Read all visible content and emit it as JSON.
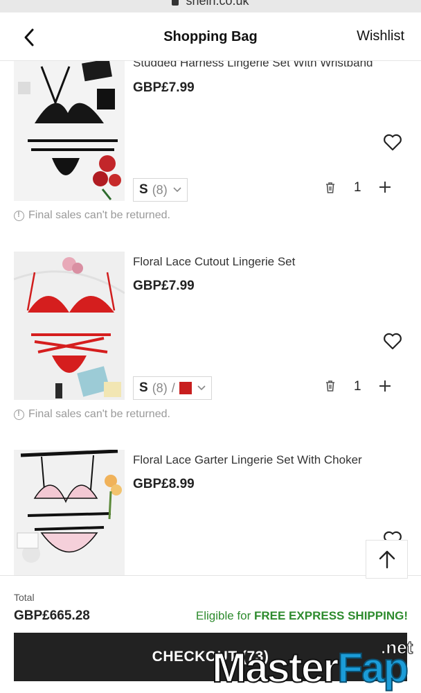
{
  "browser": {
    "url": "shein.co.uk"
  },
  "header": {
    "title": "Shopping Bag",
    "wishlist": "Wishlist"
  },
  "items": [
    {
      "name": "Studded Harness Lingerie Set With Wristband",
      "price": "GBP£7.99",
      "size": "S",
      "size_count": "(8)",
      "quantity": "1",
      "note": "Final sales can't be returned."
    },
    {
      "name": "Floral Lace Cutout Lingerie Set",
      "price": "GBP£7.99",
      "size": "S",
      "size_count": "(8)",
      "size_sep": "/",
      "swatch_color": "#c81e1e",
      "quantity": "1",
      "note": "Final sales can't be returned."
    },
    {
      "name": "Floral Lace Garter Lingerie Set With Choker",
      "price": "GBP£8.99"
    }
  ],
  "footer": {
    "total_label": "Total",
    "total_value": "GBP£665.28",
    "shipping_prefix": "Eligible for ",
    "shipping_highlight": "FREE EXPRESS SHIPPING!",
    "checkout_label": "CHECKOUT (73)"
  },
  "watermark": {
    "main": "Master",
    "accent": "Fap",
    "suffix": ".net"
  },
  "colors": {
    "shipping_green": "#2e8b2e",
    "checkout_bg": "#222222",
    "swatch_red": "#c81e1e"
  }
}
